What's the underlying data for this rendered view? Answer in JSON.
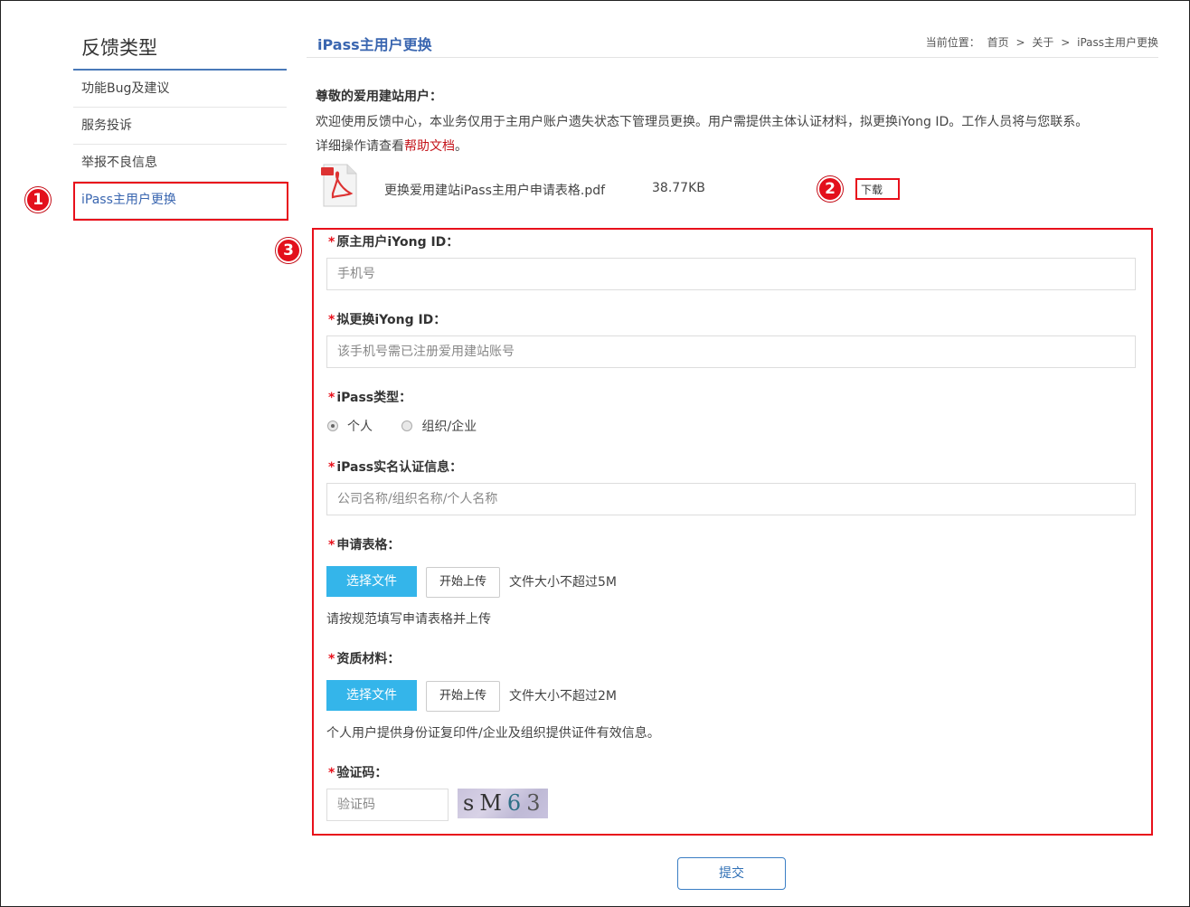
{
  "sidebar": {
    "title": "反馈类型",
    "items": [
      {
        "label": "功能Bug及建议"
      },
      {
        "label": "服务投诉"
      },
      {
        "label": "举报不良信息"
      },
      {
        "label": "iPass主用户更换"
      }
    ]
  },
  "badges": [
    "1",
    "2",
    "3"
  ],
  "header": {
    "title": "iPass主用户更换",
    "breadcrumb": {
      "prefix": "当前位置：",
      "items": [
        "首页",
        "关于",
        "iPass主用户更换"
      ],
      "separator": ">"
    }
  },
  "intro": {
    "greeting": "尊敬的爱用建站用户：",
    "line1": "欢迎使用反馈中心，本业务仅用于主用户账户遗失状态下管理员更换。用户需提供主体认证材料，拟更换iYong ID。工作人员将与您联系。",
    "line2_prefix": "详细操作请查看",
    "help_link": "帮助文档",
    "line2_suffix": "。"
  },
  "attachment": {
    "file_name": "更换爱用建站iPass主用户申请表格.pdf",
    "file_size": "38.77KB",
    "download_label": "下载",
    "icon": "pdf-file-icon"
  },
  "form": {
    "required_mark": "*",
    "original_id": {
      "label": "原主用户iYong ID：",
      "placeholder": "手机号"
    },
    "new_id": {
      "label": "拟更换iYong ID：",
      "placeholder": "该手机号需已注册爱用建站账号"
    },
    "ipass_type": {
      "label": "iPass类型：",
      "options": [
        "个人",
        "组织/企业"
      ],
      "selected": "个人"
    },
    "realname": {
      "label": "iPass实名认证信息：",
      "placeholder": "公司名称/组织名称/个人名称"
    },
    "application_form": {
      "label": "申请表格：",
      "choose_label": "选择文件",
      "upload_label": "开始上传",
      "size_hint": "文件大小不超过5M",
      "note": "请按规范填写申请表格并上传"
    },
    "qualification": {
      "label": "资质材料：",
      "choose_label": "选择文件",
      "upload_label": "开始上传",
      "size_hint": "文件大小不超过2M",
      "note": "个人用户提供身份证复印件/企业及组织提供证件有效信息。"
    },
    "captcha": {
      "label": "验证码：",
      "placeholder": "验证码",
      "chars": [
        "s",
        "M",
        "6",
        "3"
      ]
    },
    "submit_label": "提交"
  },
  "colors": {
    "accent": "#3a66b0",
    "highlight": "#e8101b",
    "file_button": "#34b5ea",
    "link": "#c4141b"
  }
}
